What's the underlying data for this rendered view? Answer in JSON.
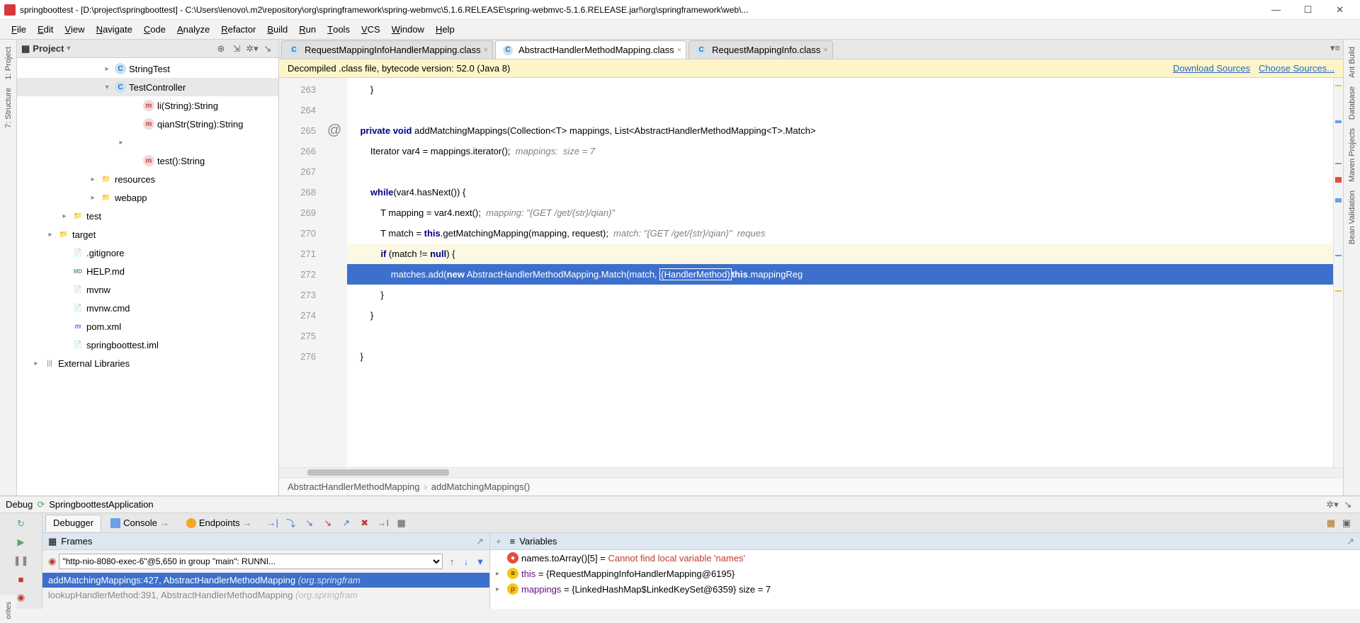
{
  "titlebar": {
    "text": "springboottest - [D:\\project\\springboottest] - C:\\Users\\lenovo\\.m2\\repository\\org\\springframework\\spring-webmvc\\5.1.6.RELEASE\\spring-webmvc-5.1.6.RELEASE.jar!\\org\\springframework\\web\\..."
  },
  "menu": [
    "File",
    "Edit",
    "View",
    "Navigate",
    "Code",
    "Analyze",
    "Refactor",
    "Build",
    "Run",
    "Tools",
    "VCS",
    "Window",
    "Help"
  ],
  "leftGutter": [
    {
      "label": "1: Project",
      "icon": "project"
    },
    {
      "label": "7: Structure",
      "icon": "structure"
    }
  ],
  "rightGutter": [
    {
      "label": "Ant Build",
      "icon": "ant"
    },
    {
      "label": "Database",
      "icon": "db"
    },
    {
      "label": "Maven Projects",
      "icon": "maven"
    },
    {
      "label": "Bean Validation",
      "icon": "bean"
    }
  ],
  "project": {
    "title": "Project",
    "tree": [
      {
        "indent": 120,
        "arrow": ">",
        "iconClass": "icon-class",
        "iconText": "C",
        "label": "StringTest"
      },
      {
        "indent": 120,
        "arrow": "v",
        "iconClass": "icon-class",
        "iconText": "C",
        "label": "TestController",
        "selected": true
      },
      {
        "indent": 160,
        "arrow": "",
        "iconClass": "icon-method",
        "iconText": "m",
        "label": "li(String):String"
      },
      {
        "indent": 160,
        "arrow": "",
        "iconClass": "icon-method",
        "iconText": "m",
        "label": "qianStr(String):String"
      },
      {
        "indent": 140,
        "arrow": ">",
        "iconClass": "",
        "iconText": "",
        "label": ""
      },
      {
        "indent": 160,
        "arrow": "",
        "iconClass": "icon-method",
        "iconText": "m",
        "label": "test():String"
      },
      {
        "indent": 100,
        "arrow": ">",
        "iconClass": "icon-folder",
        "iconText": "📁",
        "label": "resources"
      },
      {
        "indent": 100,
        "arrow": ">",
        "iconClass": "icon-folder",
        "iconText": "📁",
        "label": "webapp"
      },
      {
        "indent": 60,
        "arrow": ">",
        "iconClass": "icon-folder",
        "iconText": "📁",
        "label": "test"
      },
      {
        "indent": 40,
        "arrow": ">",
        "iconClass": "icon-folder-o",
        "iconText": "📁",
        "label": "target"
      },
      {
        "indent": 60,
        "arrow": "",
        "iconClass": "icon-file",
        "iconText": "📄",
        "label": ".gitignore"
      },
      {
        "indent": 60,
        "arrow": "",
        "iconClass": "icon-md",
        "iconText": "MD",
        "label": "HELP.md"
      },
      {
        "indent": 60,
        "arrow": "",
        "iconClass": "icon-file",
        "iconText": "📄",
        "label": "mvnw"
      },
      {
        "indent": 60,
        "arrow": "",
        "iconClass": "icon-file",
        "iconText": "📄",
        "label": "mvnw.cmd"
      },
      {
        "indent": 60,
        "arrow": "",
        "iconClass": "icon-xml",
        "iconText": "m",
        "label": "pom.xml"
      },
      {
        "indent": 60,
        "arrow": "",
        "iconClass": "icon-file",
        "iconText": "📄",
        "label": "springboottest.iml"
      },
      {
        "indent": 20,
        "arrow": ">",
        "iconClass": "icon-lib",
        "iconText": "|||",
        "label": "External Libraries"
      }
    ]
  },
  "editor": {
    "tabs": [
      {
        "label": "RequestMappingInfoHandlerMapping.class",
        "active": false
      },
      {
        "label": "AbstractHandlerMethodMapping.class",
        "active": true
      },
      {
        "label": "RequestMappingInfo.class",
        "active": false
      }
    ],
    "banner": {
      "text": "Decompiled .class file, bytecode version: 52.0 (Java 8)",
      "link1": "Download Sources",
      "link2": "Choose Sources..."
    },
    "lineStart": 263,
    "lines": [
      {
        "n": 263,
        "html": "        }"
      },
      {
        "n": 264,
        "html": ""
      },
      {
        "n": 265,
        "html": "    <span class='kw'>private void</span> addMatchingMappings(Collection&lt;T&gt; mappings, List&lt;AbstractHandlerMethodMapping&lt;T&gt;.Match&gt;",
        "gutter": "@"
      },
      {
        "n": 266,
        "html": "        Iterator var4 = mappings.iterator();  <span class='comment'>mappings:  size = 7</span>"
      },
      {
        "n": 267,
        "html": ""
      },
      {
        "n": 268,
        "html": "        <span class='kw'>while</span>(var4.hasNext()) {"
      },
      {
        "n": 269,
        "html": "            T mapping = var4.next();  <span class='comment'>mapping: \"{GET /get/{str}/qian}\"</span>"
      },
      {
        "n": 270,
        "html": "            T match = <span class='kw'>this</span>.getMatchingMapping(mapping, request);  <span class='comment'>match: \"{GET /get/{str}/qian}\"  reques</span>"
      },
      {
        "n": 271,
        "html": "            <span class='kw'>if</span> (match != <span class='kw'>null</span>) {",
        "paused": true
      },
      {
        "n": 272,
        "html": "                matches.add(<span class='kw'>new</span> AbstractHandlerMethodMapping.Match(match, <span class='boxed'>(HandlerMethod)</span><span class='kw'>this</span>.mappingReg",
        "active": true
      },
      {
        "n": 273,
        "html": "            }"
      },
      {
        "n": 274,
        "html": "        }"
      },
      {
        "n": 275,
        "html": ""
      },
      {
        "n": 276,
        "html": "    }"
      }
    ],
    "breadcrumb": [
      "AbstractHandlerMethodMapping",
      "addMatchingMappings()"
    ]
  },
  "debug": {
    "title": "Debug",
    "app": "SpringboottestApplication",
    "tabs": [
      "Debugger",
      "Console",
      "Endpoints"
    ],
    "thread": "\"http-nio-8080-exec-6\"@5,650 in group \"main\": RUNNI...",
    "frames": {
      "title": "Frames",
      "rows": [
        {
          "text": "addMatchingMappings:427, AbstractHandlerMethodMapping",
          "pkg": "(org.springfram",
          "sel": true
        },
        {
          "text": "lookupHandlerMethod:391, AbstractHandlerMethodMapping",
          "pkg": "(org.springfram",
          "dim": true
        }
      ]
    },
    "vars": {
      "title": "Variables",
      "rows": [
        {
          "arrow": "",
          "icon": "err",
          "nameHtml": "names.toArray()[5] = <span class='var-err-txt'>Cannot find local variable 'names'</span>"
        },
        {
          "arrow": ">",
          "icon": "obj",
          "nameHtml": "<span class='var-name'>this</span> = {RequestMappingInfoHandlerMapping@6195}"
        },
        {
          "arrow": ">",
          "icon": "par",
          "nameHtml": "<span class='var-name'>mappings</span> = {LinkedHashMap$LinkedKeySet@6359}  size = 7"
        }
      ]
    }
  }
}
